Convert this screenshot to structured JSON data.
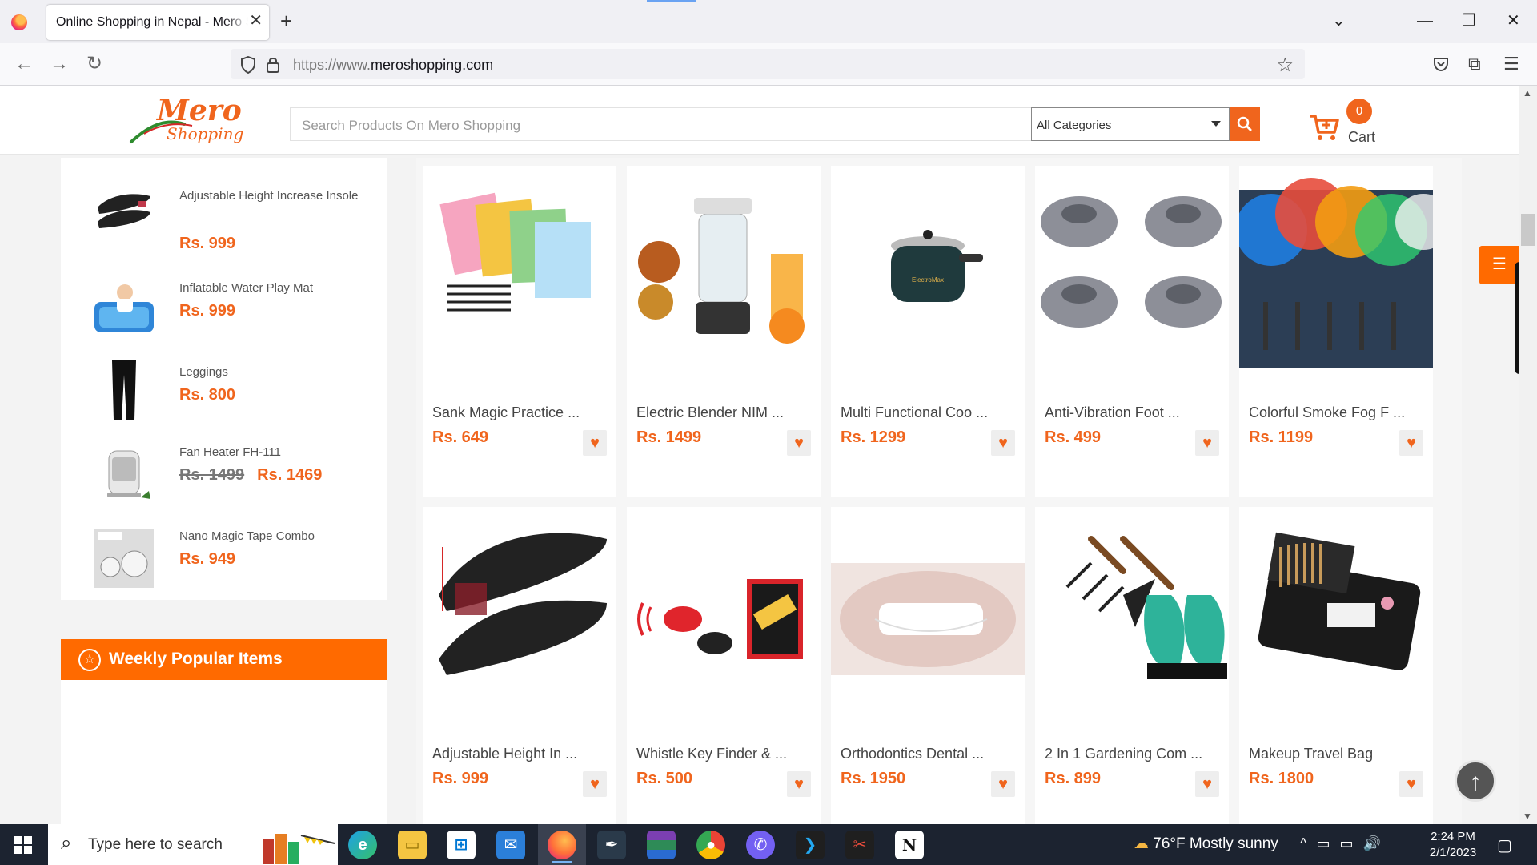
{
  "browser": {
    "tab_title": "Online Shopping in Nepal - Mero Shopping",
    "url_prefix": "https://www.",
    "url_domain": "meroshopping.com",
    "icons": [
      "back-arrow-icon",
      "forward-arrow-icon",
      "reload-icon",
      "shield-icon",
      "lock-icon",
      "star-icon",
      "pocket-icon",
      "extensions-icon",
      "menu-icon"
    ]
  },
  "header": {
    "logo_text": "Mero",
    "logo_subtext": "Shopping",
    "search_placeholder": "Search Products On Mero Shopping",
    "category_selected": "All Categories",
    "cart_count": "0",
    "cart_label": "Cart",
    "accent_color": "#f0651d"
  },
  "sidebar": {
    "items": [
      {
        "name": "Adjustable Height Increase Insole",
        "price": "Rs. 999",
        "old_price": ""
      },
      {
        "name": "Inflatable Water Play Mat",
        "price": "Rs. 999",
        "old_price": ""
      },
      {
        "name": "Leggings",
        "price": "Rs. 800",
        "old_price": ""
      },
      {
        "name": "Fan Heater FH-111",
        "price": "Rs. 1469",
        "old_price": "Rs. 1499"
      },
      {
        "name": "Nano Magic Tape Combo",
        "price": "Rs. 949",
        "old_price": ""
      }
    ],
    "weekly_title": "Weekly Popular Items"
  },
  "products": [
    {
      "name": "Sank Magic Practice ...",
      "price": "Rs. 649"
    },
    {
      "name": "Electric Blender NIM ...",
      "price": "Rs. 1499"
    },
    {
      "name": "Multi Functional Coo ...",
      "price": "Rs. 1299"
    },
    {
      "name": "Anti-Vibration Foot ...",
      "price": "Rs. 499"
    },
    {
      "name": "Colorful Smoke Fog F ...",
      "price": "Rs. 1199"
    },
    {
      "name": "Adjustable Height In ...",
      "price": "Rs. 999"
    },
    {
      "name": "Whistle Key Finder & ...",
      "price": "Rs. 500"
    },
    {
      "name": "Orthodontics Dental ...",
      "price": "Rs. 1950"
    },
    {
      "name": "2 In 1 Gardening Com ...",
      "price": "Rs. 899"
    },
    {
      "name": "Makeup Travel Bag",
      "price": "Rs. 1800"
    }
  ],
  "taskbar": {
    "search_text": "Type here to search",
    "weather": "76°F  Mostly sunny",
    "time": "2:24 PM",
    "date": "2/1/2023",
    "apps": [
      "edge-icon",
      "file-explorer-icon",
      "store-icon",
      "mail-icon",
      "firefox-icon",
      "inkscape-icon",
      "winrar-icon",
      "chrome-icon",
      "viber-icon",
      "vscode-icon",
      "snipping-tool-icon",
      "notion-icon"
    ]
  }
}
